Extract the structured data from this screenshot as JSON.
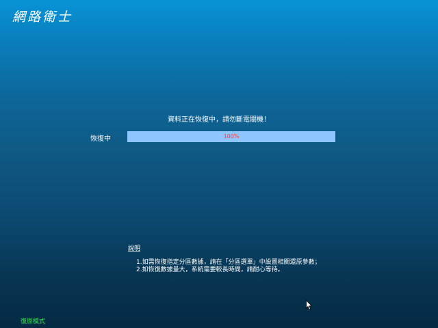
{
  "app": {
    "title": "網路衛士"
  },
  "restore": {
    "status_message": "資料正在恢復中，請勿斷電關機！",
    "progress_label": "恢復中",
    "progress_percent": 100,
    "progress_text": "100%"
  },
  "notes": {
    "title": "說明",
    "items": [
      "1.如需恢復指定分區數據，請在「分區選單」中設置相關還原參數；",
      "2.如恢復數據量大，系統需要較長時間，請耐心等待。"
    ]
  },
  "footer": {
    "mode_label": "復原模式"
  },
  "colors": {
    "progress_fill": "#8fc6ff",
    "progress_text": "#ff3b3b",
    "footer_text": "#33e04d"
  }
}
